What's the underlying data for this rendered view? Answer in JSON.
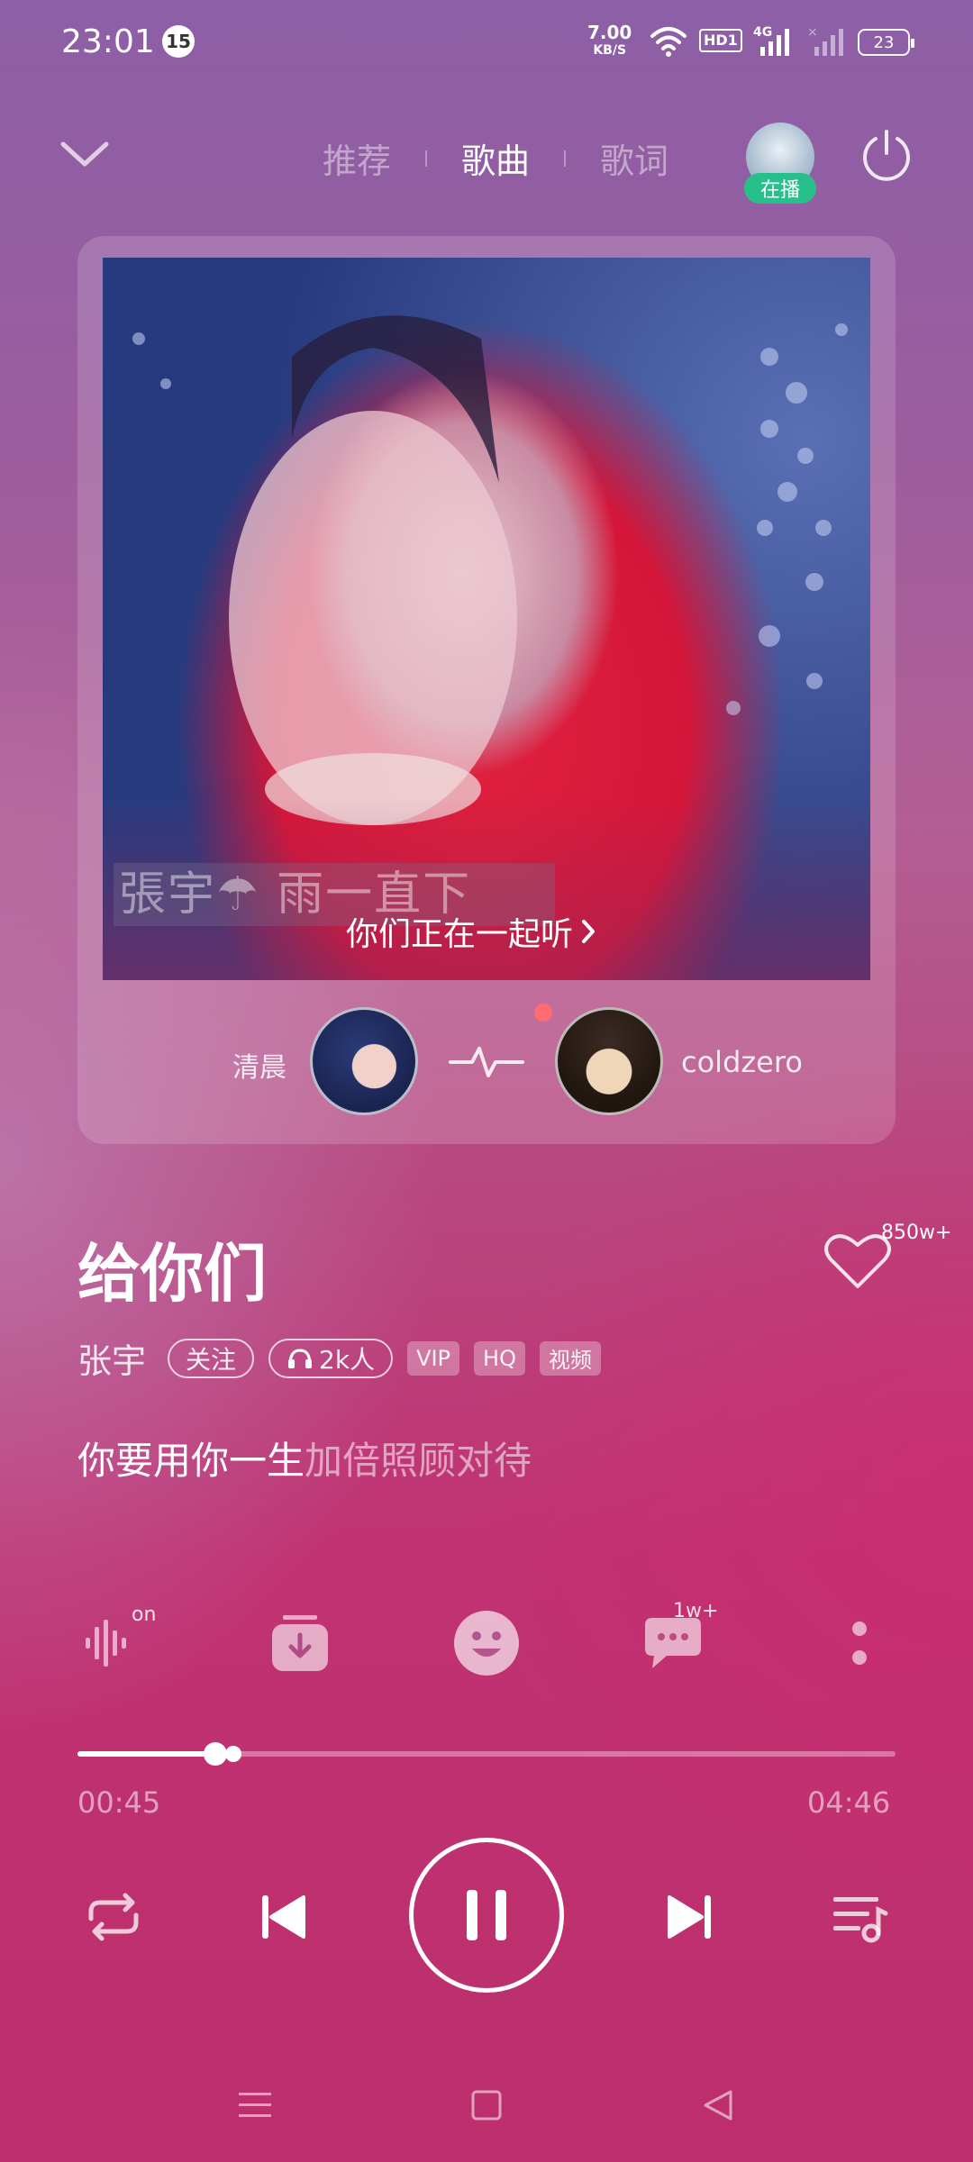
{
  "status_bar": {
    "time": "23:01",
    "notification_count": "15",
    "net_speed": "7.00",
    "net_speed_unit": "KB/S",
    "hd_label": "HD1",
    "net_type": "4G",
    "battery": "23"
  },
  "header": {
    "tabs": [
      {
        "label": "推荐",
        "active": false
      },
      {
        "label": "歌曲",
        "active": true
      },
      {
        "label": "歌词",
        "active": false
      }
    ],
    "playing_badge": "在播"
  },
  "cover": {
    "overlay_text": "張宇☂ 雨一直下",
    "listen_together": "你们正在一起听"
  },
  "listeners": {
    "left_name": "清晨",
    "right_name": "coldzero"
  },
  "song": {
    "title": "给你们",
    "likes": "850w+",
    "artist": "张宇",
    "follow": "关注",
    "listeners_count": "2k人",
    "tags": [
      "VIP",
      "HQ",
      "视频"
    ],
    "lyric_sung": "你要用你一生",
    "lyric_rest": "加倍照顾对待"
  },
  "actions": {
    "sound_effect_badge": "on",
    "comments_count": "1w+"
  },
  "progress": {
    "current": "00:45",
    "total": "04:46",
    "played_fraction": 0.168,
    "buffered_fraction": 0.19
  },
  "colors": {
    "accent_green": "#27c08a",
    "dot_red": "#ff6a73"
  }
}
